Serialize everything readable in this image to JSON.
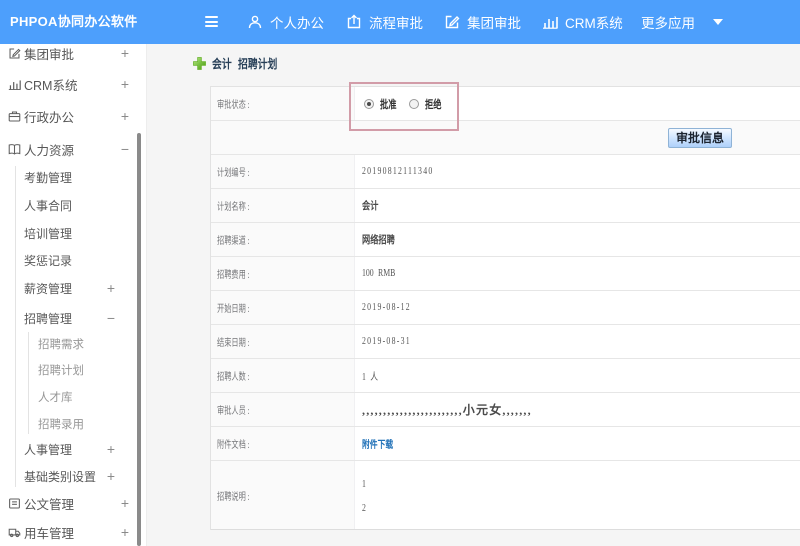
{
  "header": {
    "brand": "PHPOA协同办公软件",
    "nav": [
      {
        "label": "个人办公"
      },
      {
        "label": "流程审批"
      },
      {
        "label": "集团审批"
      },
      {
        "label": "CRM系统"
      },
      {
        "label": "更多应用"
      }
    ]
  },
  "sidebar": {
    "items": [
      {
        "label": "集团审批",
        "expander": "+"
      },
      {
        "label": "CRM系统",
        "expander": "+"
      },
      {
        "label": "行政办公",
        "expander": "+"
      },
      {
        "label": "人力资源",
        "expander": "−"
      },
      {
        "label": "考勤管理",
        "expander": ""
      },
      {
        "label": "人事合同",
        "expander": ""
      },
      {
        "label": "培训管理",
        "expander": ""
      },
      {
        "label": "奖惩记录",
        "expander": ""
      },
      {
        "label": "薪资管理",
        "expander": "+"
      },
      {
        "label": "招聘管理",
        "expander": "−"
      },
      {
        "label": "招聘需求",
        "expander": ""
      },
      {
        "label": "招聘计划",
        "expander": ""
      },
      {
        "label": "人才库",
        "expander": ""
      },
      {
        "label": "招聘录用",
        "expander": ""
      },
      {
        "label": "人事管理",
        "expander": "+"
      },
      {
        "label": "基础类别设置",
        "expander": "+"
      },
      {
        "label": "公文管理",
        "expander": "+"
      },
      {
        "label": "用车管理",
        "expander": "+"
      }
    ]
  },
  "page": {
    "title_prefix": "会计",
    "title": "招聘计划"
  },
  "form": {
    "status_label": "审批状态 :",
    "status_options": [
      {
        "label": "批准",
        "selected": true
      },
      {
        "label": "拒绝",
        "selected": false
      }
    ],
    "approve_button": "审批信息",
    "rows": [
      {
        "label": "计划编号 :",
        "value": "20190812111340"
      },
      {
        "label": "计划名称 :",
        "value": "会计"
      },
      {
        "label": "招聘渠道 :",
        "value": "网络招聘"
      },
      {
        "label": "招聘费用 :",
        "value": "100 RMB"
      },
      {
        "label": "开始日期 :",
        "value": "2019-08-12"
      },
      {
        "label": "结束日期 :",
        "value": "2019-08-31"
      },
      {
        "label": "招聘人数 :",
        "value": "1 人"
      },
      {
        "label": "审批人员 :",
        "value": ",,,,,,,,,,,,,,,,,,,,,,,,小元女,,,,,,,"
      },
      {
        "label": "附件文档 :",
        "value": "附件下载"
      },
      {
        "label": "招聘说明 :",
        "lines": [
          "1",
          "2"
        ]
      }
    ]
  },
  "colors": {
    "topbar": "#4d9ffc",
    "highlight_box": "#c9798a",
    "link": "#2272b8",
    "title_text": "#273f57"
  }
}
